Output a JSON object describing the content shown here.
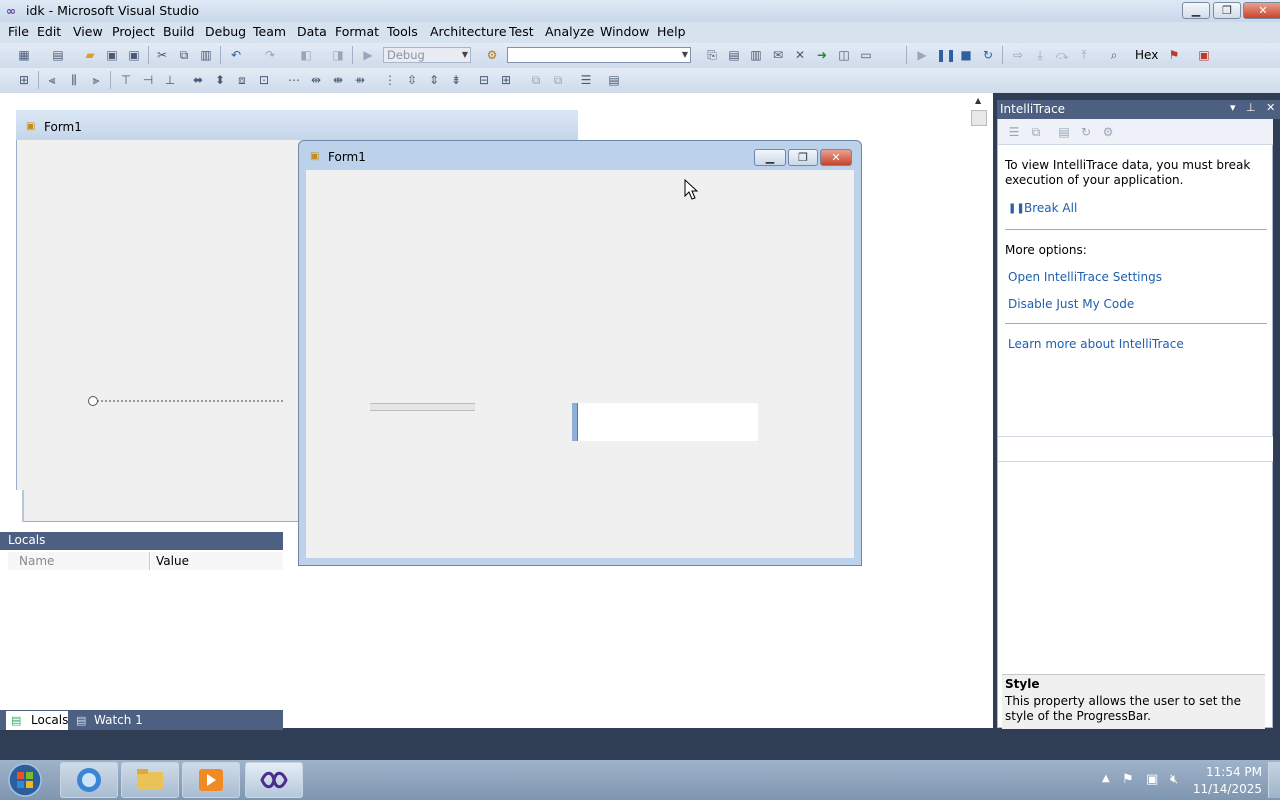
{
  "window": {
    "title": "idk - Microsoft Visual Studio",
    "caption_buttons": {
      "minimize": "▁",
      "restore": "❐",
      "close": "✕"
    }
  },
  "menu": [
    "File",
    "Edit",
    "View",
    "Project",
    "Build",
    "Debug",
    "Team",
    "Data",
    "Format",
    "Tools",
    "Architecture",
    "Test",
    "Analyze",
    "Window",
    "Help"
  ],
  "toolbar": {
    "configuration": "Debug",
    "platform": "",
    "hex_label": "Hex"
  },
  "designer": {
    "form_title": "Form1"
  },
  "locals": {
    "title": "Locals",
    "columns": [
      "Name",
      "Value"
    ],
    "tabs": [
      "Locals",
      "Watch 1"
    ]
  },
  "running_form": {
    "title": "Form1",
    "textbox_value": ""
  },
  "intellitrace": {
    "title": "IntelliTrace",
    "message": "To view IntelliTrace data, you must break execution of your application.",
    "break_all": "Break All",
    "more_options": "More options:",
    "links": [
      "Open IntelliTrace Settings",
      "Disable Just My Code",
      "Learn more about IntelliTrace"
    ]
  },
  "property_description": {
    "title": "Style",
    "text": "This property allows the user to set the style of the ProgressBar."
  },
  "taskbar": {
    "time": "11:54 PM",
    "date": "11/14/2025"
  },
  "colors": {
    "accent": "#4d6082",
    "link": "#1e5fae",
    "taskbar": "#8fa4bd"
  }
}
